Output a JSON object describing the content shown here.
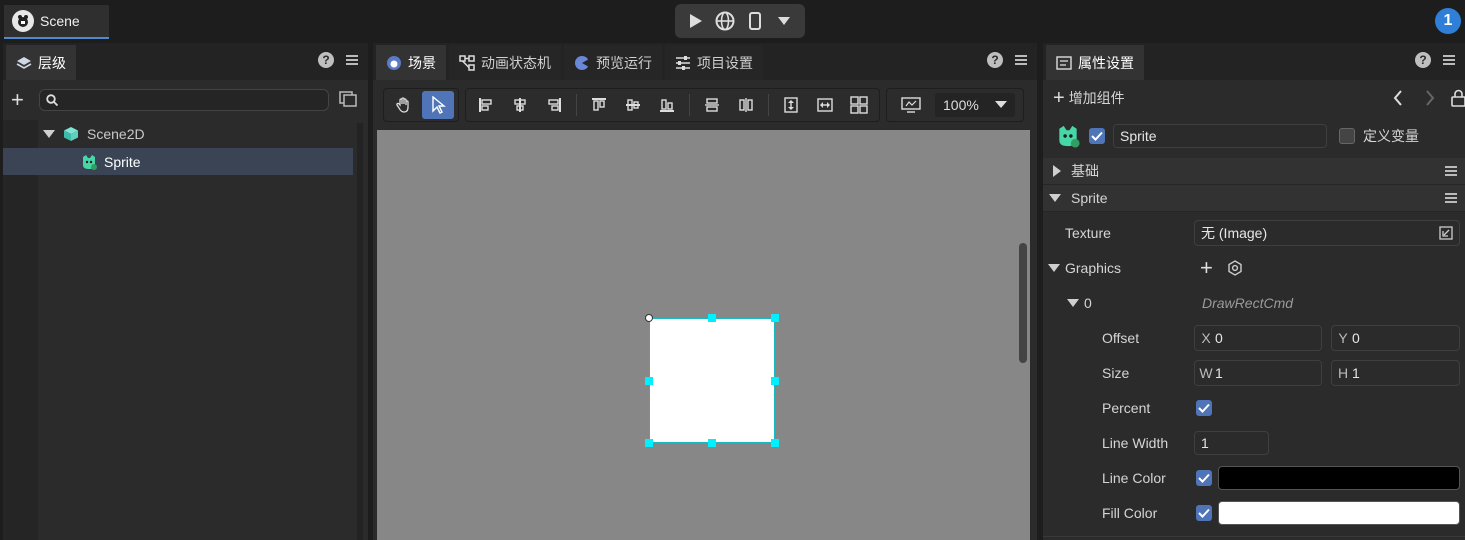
{
  "top": {
    "doc_tab": "Scene",
    "user_badge": "1"
  },
  "hierarchy": {
    "tab": "层级",
    "search_placeholder": "",
    "items": [
      {
        "label": "Scene2D"
      },
      {
        "label": "Sprite"
      }
    ]
  },
  "scene": {
    "tabs": [
      "场景",
      "动画状态机",
      "预览运行",
      "项目设置"
    ],
    "zoom": "100%"
  },
  "props": {
    "tab": "属性设置",
    "add_component": "增加组件",
    "node_name": "Sprite",
    "define_var": "定义变量",
    "sections": {
      "basic": "基础",
      "sprite": "Sprite"
    },
    "texture_label": "Texture",
    "texture_value": "无 (Image)",
    "graphics_label": "Graphics",
    "cmd_index": "0",
    "cmd_type": "DrawRectCmd",
    "offset_label": "Offset",
    "offset_x_axis": "X",
    "offset_x": "0",
    "offset_y_axis": "Y",
    "offset_y": "0",
    "size_label": "Size",
    "size_w_axis": "W",
    "size_w": "1",
    "size_h_axis": "H",
    "size_h": "1",
    "percent_label": "Percent",
    "line_width_label": "Line Width",
    "line_width": "1",
    "line_color_label": "Line Color",
    "line_color": "#000000",
    "fill_color_label": "Fill Color",
    "fill_color": "#ffffff"
  },
  "colors": {
    "accent": "#4f74b8",
    "selection_handle": "#00f0ff"
  }
}
